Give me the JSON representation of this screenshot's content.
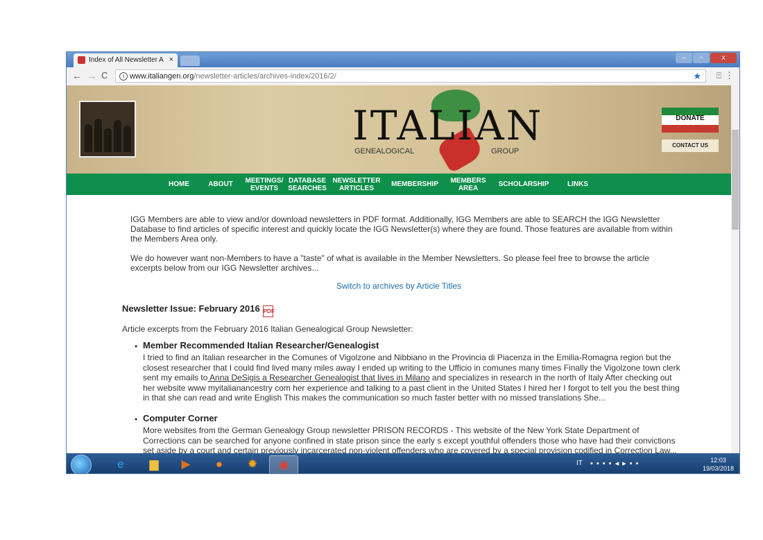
{
  "browser": {
    "tab_title": "Index of All Newsletter A",
    "tab_close": "×",
    "url_host": "www.italiangen.org",
    "url_path": "/newsletter-articles/archives-index/2016/2/",
    "back": "←",
    "forward": "→",
    "reload": "C",
    "info": "i",
    "star_icon": "★",
    "menu": "⋮",
    "ext": "⍐",
    "win_min": "–",
    "win_max": "▫",
    "win_close": "x"
  },
  "site": {
    "logo_title": "ITALIAN",
    "logo_sub_left": "GENEALOGICAL",
    "logo_sub_right": "GROUP",
    "donate": "DONATE",
    "contact": "CONTACT US",
    "nav": [
      {
        "label": "HOME"
      },
      {
        "label": "ABOUT"
      },
      {
        "label": "MEETINGS/ EVENTS"
      },
      {
        "label": "DATABASE SEARCHES"
      },
      {
        "label": "NEWSLETTER ARTICLES"
      },
      {
        "label": "MEMBERSHIP"
      },
      {
        "label": "MEMBERS AREA"
      },
      {
        "label": "SCHOLARSHIP"
      },
      {
        "label": "LINKS"
      }
    ]
  },
  "content": {
    "intro1": "IGG Members are able to view and/or download newsletters in PDF format. Additionally, IGG Members are able to SEARCH the IGG Newsletter Database to find articles of specific interest and quickly locate the IGG Newsletter(s) where they are found. Those features are available from within the Members Area only.",
    "intro2": "We do however want non-Members to have a \"taste\" of what is available in the Member Newsletters. So please feel free to browse the article excerpts below from our IGG Newsletter archives...",
    "switch_link": "Switch to archives by Article Titles",
    "issue_heading": "Newsletter Issue: February 2016",
    "pdf_icon_label": "PDF",
    "excerpts_intro": "Article excerpts from the February 2016 Italian Genealogical Group Newsletter:",
    "articles": [
      {
        "title": "Member Recommended Italian Researcher/Genealogist",
        "text_a": "I tried to find an Italian researcher in the Comunes of Vigolzone and Nibbiano in the Provincia di Piacenza in the Emilia-Romagna region but the closest researcher that I could find lived many miles away I ended up writing to the Ufficio in comunes many times Finally the Vigolzone town clerk sent my emails to",
        "text_link": " Anna DeSigis a Researcher Genealogist that lives in Milano",
        "text_b": " and specializes in research in the north of Italy After checking out her website www myitalianancestry com her experience and talking to a past client in the United States I hired her I forgot to tell you the best thing in that she can read and write English This makes the communication so much faster better with no missed translations She..."
      },
      {
        "title": "Computer Corner",
        "text": "More websites from the German Genealogy Group newsletter PRISON RECORDS - This website of the New York State Department of Corrections can be searched for anyone confined in state prison since the early s except youthful offenders those who have had their convictions set aside by a court and certain previously incarcerated non-violent offenders who are covered by a special provision codified in Correction Law..."
      }
    ]
  },
  "taskbar": {
    "lang": "IT",
    "time": "12:03",
    "date": "19/03/2018"
  }
}
